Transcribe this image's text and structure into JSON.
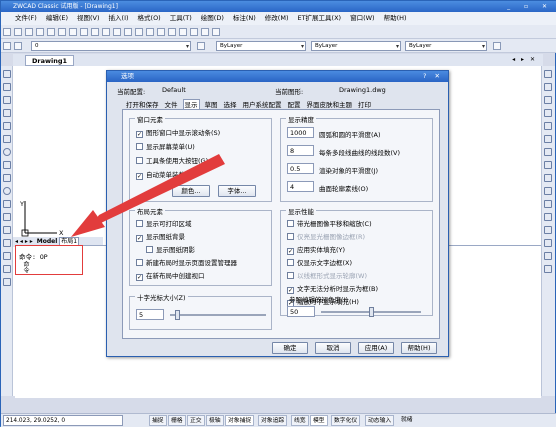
{
  "app": {
    "title": "ZWCAD Classic 试用版 - [Drawing1]",
    "window_controls": "_ ▫ ✕",
    "menu": [
      "文件(F)",
      "编辑(E)",
      "视图(V)",
      "插入(I)",
      "格式(O)",
      "工具(T)",
      "绘图(D)",
      "标注(N)",
      "修改(M)",
      "ET扩展工具(X)",
      "窗口(W)",
      "帮助(H)"
    ],
    "toolbar2": {
      "layer_value": "0",
      "color_value": "ByLayer",
      "linetype_value": "ByLayer",
      "lineweight_value": "ByLayer"
    },
    "doc_tab": "Drawing1",
    "doc_tab_controls": "◂ ▸ ✕",
    "model_tabs": {
      "nav": "◂ ◂ ▸ ▸",
      "model": "Model",
      "layout": "布局1"
    },
    "axis_x": "X",
    "axis_y": "Y",
    "command_text": "命令: OP",
    "command_label": "命令",
    "status": {
      "coords": "214.023,  29.0252,  0",
      "buttons": [
        "捕捉",
        "栅格",
        "正交",
        "极轴",
        "对象捕捉",
        "对象追踪",
        "线宽",
        "模型",
        "数字化仪",
        "动态输入",
        "就绪"
      ]
    }
  },
  "dialog": {
    "title": "选项",
    "controls": "?  ✕",
    "profile_label": "当前配置:",
    "profile_value": "Default",
    "drawing_label": "当前图形:",
    "drawing_value": "Drawing1.dwg",
    "tabs": [
      "打开和保存",
      "文件",
      "显示",
      "草图",
      "选择",
      "用户系统配置",
      "配置",
      "界面皮肤和主题",
      "打印"
    ],
    "active_tab": "显示",
    "window_elements": {
      "title": "窗口元素",
      "items": [
        {
          "label": "图形窗口中显示滚动条(S)",
          "checked": true
        },
        {
          "label": "显示屏幕菜单(U)",
          "checked": false
        },
        {
          "label": "工具条使用大按钮(G)",
          "checked": false
        },
        {
          "label": "自动菜单装载(E)",
          "checked": true
        }
      ],
      "color_button": "颜色...",
      "font_button": "字体..."
    },
    "layout_elements": {
      "title": "布局元素",
      "items": [
        {
          "label": "显示可打印区域",
          "checked": false
        },
        {
          "label": "显示图纸背景",
          "checked": true
        },
        {
          "label": "显示图纸阴影",
          "checked": false
        },
        {
          "label": "新建布局时显示页面设置管理器",
          "checked": false
        },
        {
          "label": "在新布局中创建视口",
          "checked": true
        }
      ]
    },
    "display_resolution": {
      "title": "显示精度",
      "items": [
        {
          "value": "1000",
          "label": "圆弧和圆的平滑度(A)"
        },
        {
          "value": "8",
          "label": "每条多段线曲线的线段数(V)"
        },
        {
          "value": "0.5",
          "label": "渲染对象的平滑度(J)"
        },
        {
          "value": "4",
          "label": "曲面轮廓素线(O)"
        }
      ]
    },
    "display_performance": {
      "title": "显示性能",
      "items": [
        {
          "label": "带光栅图像平移和缩放(C)",
          "checked": false,
          "disabled": false
        },
        {
          "label": "仅亮显光栅图像边框(R)",
          "checked": false,
          "disabled": true
        },
        {
          "label": "应用实体填充(Y)",
          "checked": true,
          "disabled": false
        },
        {
          "label": "仅显示文字边框(X)",
          "checked": false,
          "disabled": false
        },
        {
          "label": "以线框形式显示轮廓(W)",
          "checked": false,
          "disabled": true
        },
        {
          "label": "文字无法分析时显示为框(B)",
          "checked": true,
          "disabled": false
        },
        {
          "label": "缩放时不显示填充(H)",
          "checked": true,
          "disabled": false
        }
      ]
    },
    "crosshair": {
      "title": "十字光标大小(Z)",
      "value": "5",
      "level": 0.05
    },
    "xref_fade": {
      "title": "参照编辑的褪色度(I)",
      "value": "50",
      "level": 0.5
    },
    "buttons": {
      "ok": "确定",
      "cancel": "取消",
      "apply": "应用(A)",
      "help": "帮助(H)"
    }
  }
}
